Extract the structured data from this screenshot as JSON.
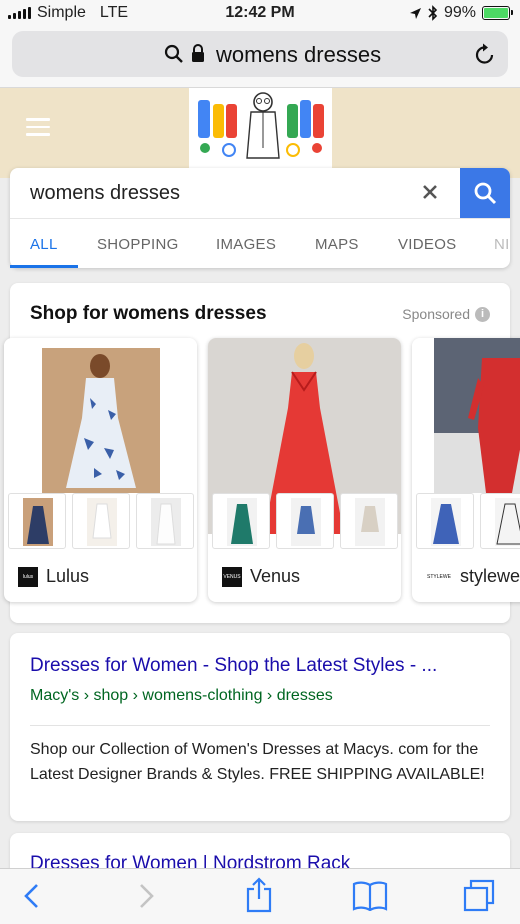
{
  "status_bar": {
    "carrier": "Simple",
    "network": "LTE",
    "time": "12:42 PM",
    "battery_percent": "99%",
    "battery_level": 0.99
  },
  "url_bar": {
    "text": "womens dresses"
  },
  "search": {
    "query": "womens dresses",
    "tabs": [
      "ALL",
      "SHOPPING",
      "IMAGES",
      "MAPS",
      "VIDEOS",
      "NI"
    ],
    "active_tab": "ALL"
  },
  "shopping": {
    "title": "Shop for womens dresses",
    "sponsored_label": "Sponsored",
    "info_glyph": "i",
    "products": [
      {
        "store": "Lulus",
        "logo_text": "lulus"
      },
      {
        "store": "Venus",
        "logo_text": "VENUS"
      },
      {
        "store": "stylewe",
        "logo_text": "STYLEWE"
      }
    ]
  },
  "results": [
    {
      "title": "Dresses for Women - Shop the Latest Styles - ...",
      "breadcrumb": "Macy's › shop › womens-clothing › dresses",
      "snippet": "Shop our Collection of Women's Dresses at Macys. com for the Latest Designer Brands & Styles. FREE SHIPPING AVAILABLE!"
    },
    {
      "title": "Dresses for Women | Nordstrom Rack"
    }
  ],
  "colors": {
    "accent_blue": "#3b78e7",
    "link": "#1a0dab",
    "url_green": "#006621",
    "header_bg": "#efe3c8"
  }
}
